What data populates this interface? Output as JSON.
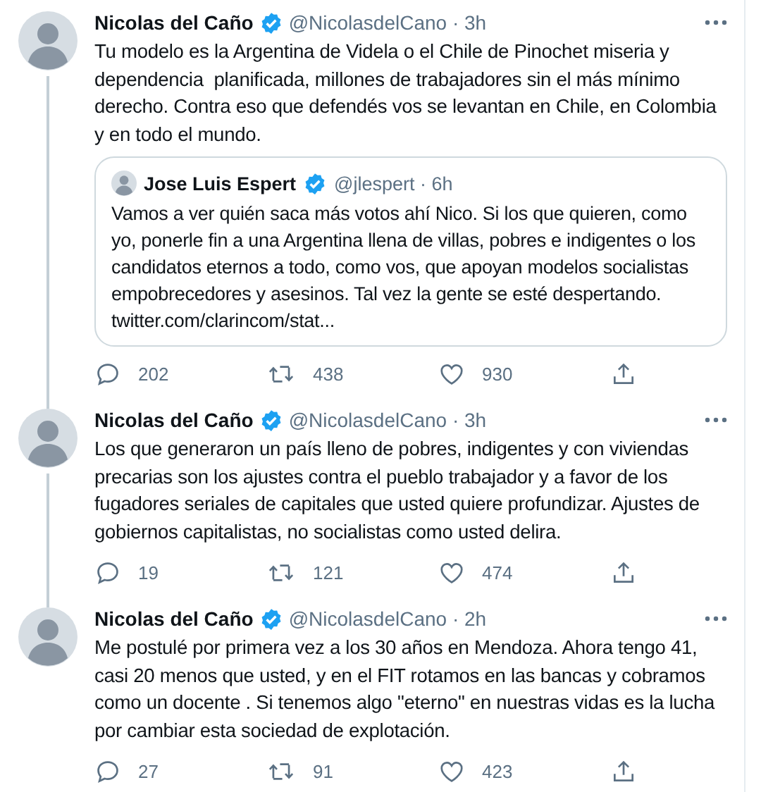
{
  "tweets": [
    {
      "author": "Nicolas del Caño",
      "verified": true,
      "meta": "@NicolasdelCano · 3h",
      "connects_next": true,
      "text": "Tu modelo es la Argentina de Videla o el Chile de Pinochet miseria y dependencia  planificada, millones de trabajadores sin el más mínimo derecho. Contra eso que defendés vos se levantan en Chile, en Colombia y en todo el mundo.",
      "quote": {
        "author": "Jose Luis Espert",
        "verified": true,
        "meta": "@jlespert · 6h",
        "text": "Vamos a ver quién saca más votos ahí Nico. Si los que quieren, como yo, ponerle fin a una Argentina llena de villas, pobres e indigentes o los candidatos eternos a todo, como vos, que apoyan modelos socialistas empobrecedores y asesinos. Tal vez la gente se esté despertando.",
        "link": "twitter.com/clarincom/stat..."
      },
      "replies": "202",
      "retweets": "438",
      "likes": "930"
    },
    {
      "author": "Nicolas del Caño",
      "verified": true,
      "meta": "@NicolasdelCano · 3h",
      "connects_next": true,
      "text": "Los que generaron un país lleno de pobres, indigentes y con viviendas precarias son los ajustes contra el pueblo trabajador y a favor de los fugadores seriales de capitales que usted quiere profundizar. Ajustes de gobiernos capitalistas, no socialistas como usted delira.",
      "replies": "19",
      "retweets": "121",
      "likes": "474"
    },
    {
      "author": "Nicolas del Caño",
      "verified": true,
      "meta": "@NicolasdelCano · 2h",
      "connects_next": false,
      "text": "Me postulé por primera vez a los 30 años en Mendoza. Ahora tengo 41, casi 20 menos que usted, y en el FIT rotamos en las bancas y cobramos como un docente . Si tenemos algo \"eterno\" en nuestras vidas es la lucha por cambiar esta sociedad de explotación.",
      "replies": "27",
      "retweets": "91",
      "likes": "423"
    }
  ]
}
